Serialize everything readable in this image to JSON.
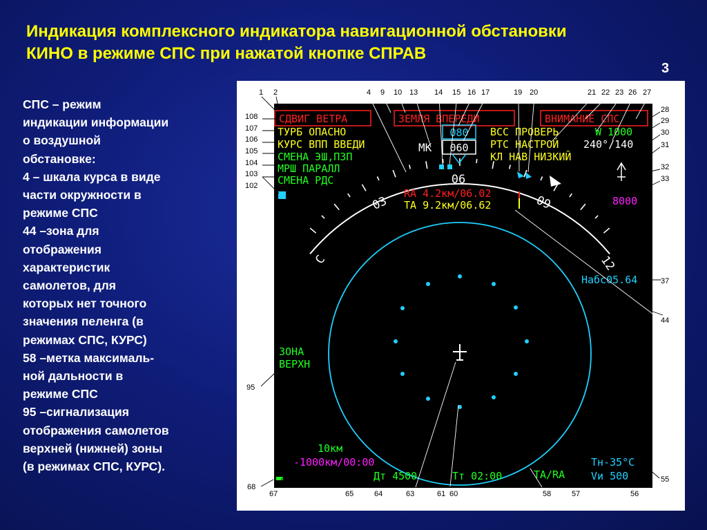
{
  "title_line1": "Индикация комплексного индикатора навигационной обстановки",
  "title_line2": "КИНО в  режиме СПС при нажатой кнопке СПРАВ",
  "slide_number": "3",
  "description": [
    "СПС – режим",
    "индикации информации",
    "о воздушной",
    "обстановке:",
    "4 – шкала курса в виде",
    "части окружности в",
    "режиме СПС",
    "44 –зона для",
    "отображения",
    "характеристик",
    "самолетов, для",
    "которых нет точного",
    "значения пеленга (в",
    "режимах СПС, КУРС)",
    "58 –метка максималь-",
    "ной дальности в",
    "режиме СПС",
    "95 –сигнализация",
    "отображения самолетов",
    "верхней (нижней) зоны",
    "(в режимах СПС, КУРС)."
  ],
  "display": {
    "warn_wind": "СДВИГ ВЕТРА",
    "warn_ground": "ЗЕМЛЯ ВПЕРЕДИ",
    "warn_attention": "ВНИМАНИЕ СПС",
    "msg1": "ТУРБ ОПАСНО",
    "msg2": "КУРС ВПП ВВЕДИ",
    "msg3": "СМЕНА ЭШ,ПЗП",
    "msg4": "МРШ ПАРАЛЛ",
    "msg5": "СМЕНА РДС",
    "course_set": "080",
    "mk_label": "МК",
    "mk_value": "060",
    "right1": "ВСС ПРОВЕРЬ",
    "right2": "РТС НАСТРОЙ",
    "right3": "КЛ НАВ НИЗКИЙ",
    "ground_speed": "W 1000",
    "wind": "240°/140",
    "altitude": "8000",
    "scale_03": "03",
    "scale_06": "06",
    "scale_09": "09",
    "scale_c": "С",
    "scale_12": "12",
    "ra": "RA 4.2км/06.02",
    "ta": "TA 9.2км/06.62",
    "habs": "Набс05.64",
    "zone1": "ЗОНА",
    "zone2": "ВЕРХН",
    "range": "10км",
    "dist_time": "-1000км/00:00",
    "dt": "Дт 4500",
    "tt": "Тт 02:00",
    "ta_ra": "TA/RA",
    "tn": "Тн-35°С",
    "vi": "Vи 500"
  },
  "callouts": {
    "top": [
      "1",
      "2",
      "4",
      "9",
      "10",
      "13",
      "14",
      "15",
      "16",
      "17",
      "19",
      "20",
      "21",
      "22",
      "23",
      "26",
      "27"
    ],
    "left": [
      "108",
      "107",
      "106",
      "105",
      "104",
      "103",
      "102"
    ],
    "right": [
      "28",
      "29",
      "30",
      "31",
      "32",
      "33",
      "37",
      "44",
      "55"
    ],
    "side95": "95",
    "bottom": [
      "68",
      "67",
      "65",
      "64",
      "63",
      "61",
      "60",
      "58",
      "57",
      "56"
    ]
  },
  "colors": {
    "title": "#ffff00",
    "background": "#0f1d7a",
    "screen": "#000000",
    "red": "#ff2020",
    "yellow": "#ffff20",
    "green": "#20ff20",
    "cyan": "#20d0ff",
    "magenta": "#ff20ff",
    "white": "#ffffff"
  }
}
